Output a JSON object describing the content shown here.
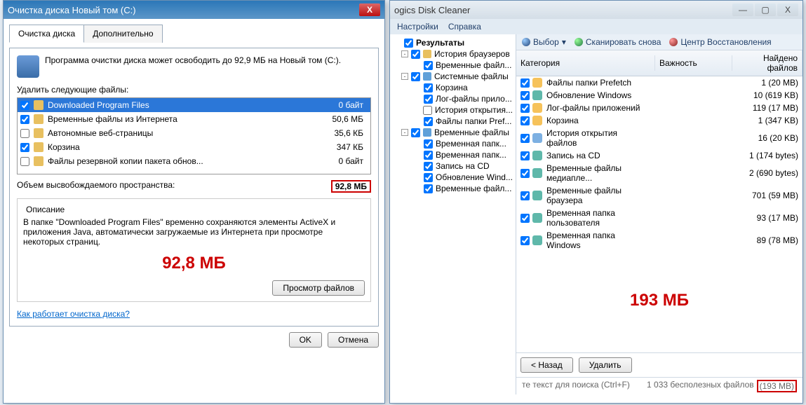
{
  "left": {
    "title": "Очистка диска Новый том (C:)",
    "tabs": {
      "t1": "Очистка диска",
      "t2": "Дополнительно"
    },
    "blurb": "Программа очистки диска может освободить до 92,9 МБ на Новый том (C:).",
    "list_label": "Удалить следующие файлы:",
    "files": [
      {
        "chk": true,
        "name": "Downloaded Program Files",
        "size": "0 байт",
        "sel": true
      },
      {
        "chk": true,
        "name": "Временные файлы из Интернета",
        "size": "50,6 МБ"
      },
      {
        "chk": false,
        "name": "Автономные веб-страницы",
        "size": "35,6 КБ"
      },
      {
        "chk": true,
        "name": "Корзина",
        "size": "347 КБ"
      },
      {
        "chk": false,
        "name": "Файлы резервной копии пакета обнов...",
        "size": "0 байт"
      }
    ],
    "freed_lbl": "Объем высвобождаемого пространства:",
    "freed_val": "92,8 МБ",
    "desc_title": "Описание",
    "desc": "В папке \"Downloaded Program Files\" временно сохраняются элементы ActiveX и приложения Java, автоматически загружаемые из Интернета при просмотре некоторых страниц.",
    "big": "92,8 МБ",
    "view_btn": "Просмотр файлов",
    "how_link": "Как работает очистка диска?",
    "ok": "OK",
    "cancel": "Отмена"
  },
  "right": {
    "title": "ogics Disk Cleaner",
    "menu": {
      "m2": "Настройки",
      "m3": "Справка"
    },
    "tree": [
      {
        "lvl": 0,
        "exp": false,
        "chk": true,
        "bold": true,
        "label": "Результаты"
      },
      {
        "lvl": 1,
        "exp": "-",
        "chk": true,
        "ico": "y",
        "label": "История браузеров"
      },
      {
        "lvl": 2,
        "chk": true,
        "label": "Временные файл..."
      },
      {
        "lvl": 1,
        "exp": "-",
        "chk": true,
        "ico": "b",
        "label": "Системные файлы"
      },
      {
        "lvl": 2,
        "chk": true,
        "label": "Корзина"
      },
      {
        "lvl": 2,
        "chk": true,
        "label": "Лог-файлы прило..."
      },
      {
        "lvl": 2,
        "chk": false,
        "label": "История открытия..."
      },
      {
        "lvl": 2,
        "chk": true,
        "label": "Файлы папки Pref..."
      },
      {
        "lvl": 1,
        "exp": "-",
        "chk": true,
        "ico": "b",
        "label": "Временные файлы"
      },
      {
        "lvl": 2,
        "chk": true,
        "label": "Временная папк..."
      },
      {
        "lvl": 2,
        "chk": true,
        "label": "Временная папк..."
      },
      {
        "lvl": 2,
        "chk": true,
        "label": "Запись на CD"
      },
      {
        "lvl": 2,
        "chk": true,
        "label": "Обновление Wind..."
      },
      {
        "lvl": 2,
        "chk": true,
        "label": "Временные файл..."
      }
    ],
    "toolbar": {
      "sel": "Выбор",
      "scan": "Сканировать снова",
      "restore": "Центр Восстановления"
    },
    "cols": {
      "cat": "Категория",
      "imp": "Важность",
      "cnt": "Найдено файлов"
    },
    "rows": [
      {
        "ico": "c1",
        "cat": "Файлы папки Prefetch",
        "imp": "g",
        "cnt": "1 (20 MB)"
      },
      {
        "ico": "c2",
        "cat": "Обновление Windows",
        "imp": "g",
        "cnt": "10 (619 KB)"
      },
      {
        "ico": "c1",
        "cat": "Лог-файлы приложений",
        "imp": "r",
        "cnt": "119 (17 MB)"
      },
      {
        "ico": "c1",
        "cat": "Корзина",
        "imp": "g",
        "cnt": "1 (347 KB)"
      },
      {
        "ico": "c3",
        "cat": "История открытия файлов",
        "imp": "g",
        "cnt": "16 (20 KB)"
      },
      {
        "ico": "c2",
        "cat": "Запись на CD",
        "imp": "g",
        "cnt": "1 (174 bytes)"
      },
      {
        "ico": "c2",
        "cat": "Временные файлы медиапле...",
        "imp": "g",
        "cnt": "2 (690 bytes)"
      },
      {
        "ico": "c2",
        "cat": "Временные файлы браузера",
        "imp": "r",
        "cnt": "701 (59 MB)"
      },
      {
        "ico": "c2",
        "cat": "Временная папка пользователя",
        "imp": "y",
        "cnt": "93 (17 MB)"
      },
      {
        "ico": "c2",
        "cat": "Временная папка Windows",
        "imp": "y",
        "cnt": "89 (78 MB)"
      }
    ],
    "big": "193 МБ",
    "back": "< Назад",
    "delete": "Удалить",
    "search_ph": "те текст для поиска (Ctrl+F)",
    "status_count": "1 033 бесполезных файлов",
    "status_size": "(193 MB)"
  }
}
